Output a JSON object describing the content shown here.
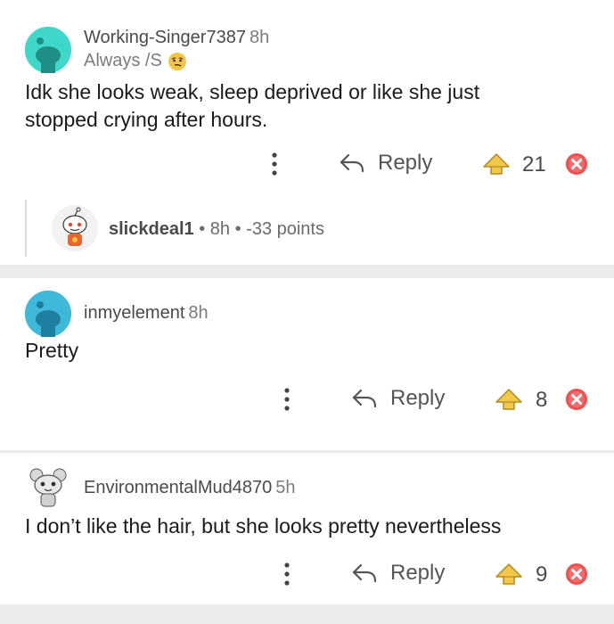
{
  "comments": [
    {
      "username": "Working-Singer7387",
      "time": "8h",
      "flair": "Always /S",
      "flair_emoji": "smirk-emoji",
      "body_lines": [
        "Idk she looks weak, sleep deprived or like she just",
        "stopped crying after hours."
      ],
      "reply_label": "Reply",
      "score": "21"
    },
    {
      "username": "inmyelement",
      "time": "8h",
      "body_lines": [
        "Pretty"
      ],
      "reply_label": "Reply",
      "score": "8"
    },
    {
      "username": "EnvironmentalMud4870",
      "time": "5h",
      "body_lines": [
        "I don’t like the hair, but she looks pretty nevertheless"
      ],
      "reply_label": "Reply",
      "score": "9"
    }
  ],
  "collapsed_reply": {
    "username": "slickdeal1",
    "time": "8h",
    "points": "-33 points",
    "separator": "•"
  },
  "icons": {
    "more": "more-vertical-icon",
    "reply": "reply-arrow-icon",
    "upvote": "upvote-icon",
    "downvote": "downvote-icon"
  },
  "colors": {
    "avatar_teal": "#3fd7c9",
    "avatar_blue": "#3fb9d9",
    "upvote_gold": "#f2c84b",
    "downvote_red": "#ef4f4f",
    "background": "#ececec"
  }
}
